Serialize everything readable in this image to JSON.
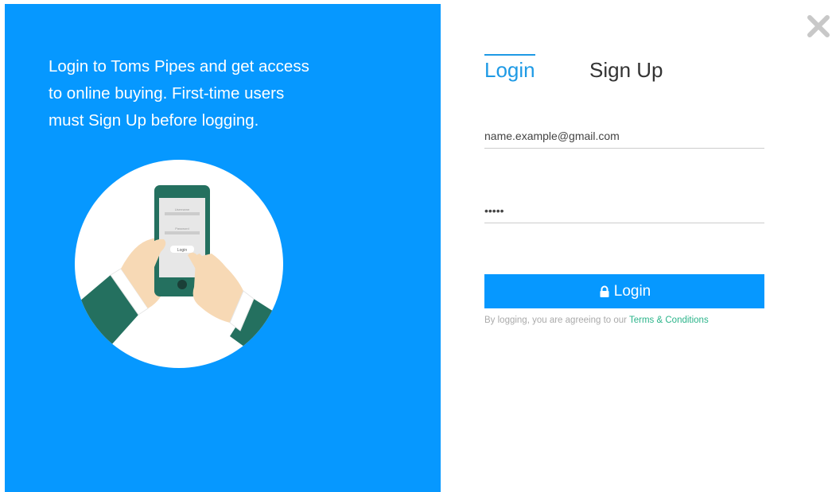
{
  "promo": {
    "text": "Login to Toms Pipes and get access to online buying. First-time users must Sign Up before logging."
  },
  "illustration": {
    "phone_field_1": "Username",
    "phone_field_2": "Password",
    "phone_button": "Login"
  },
  "tabs": {
    "login_label": "Login",
    "signup_label": "Sign Up",
    "active": "Login"
  },
  "form": {
    "email_value": "name.example@gmail.com",
    "password_value": "•••••",
    "login_button_label": "Login"
  },
  "terms": {
    "prefix": "By logging, you are agreeing to our ",
    "link_label": "Terms & Conditions"
  },
  "icons": {
    "close": "close-icon",
    "lock": "lock-icon"
  },
  "colors": {
    "primary": "#0698ff",
    "tab_active": "#1e9ae5",
    "link": "#2bb48a",
    "close_icon": "#c8c8c8"
  }
}
